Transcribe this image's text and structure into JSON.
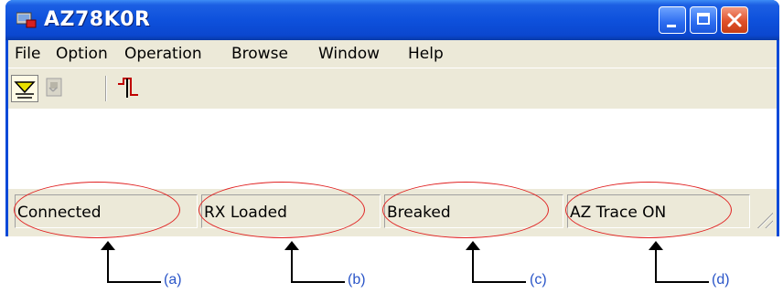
{
  "window": {
    "title": "AZ78K0R",
    "title_icon": "app-icon",
    "controls": [
      "minimize-icon",
      "maximize-icon",
      "close-icon"
    ]
  },
  "menu": {
    "items": [
      {
        "label": "File"
      },
      {
        "label": "Option"
      },
      {
        "label": "Operation"
      },
      {
        "label": "Browse"
      },
      {
        "label": "Window"
      },
      {
        "label": "Help"
      }
    ]
  },
  "toolbar": {
    "tools": [
      "filter-icon",
      "load-icon",
      "trace-signal-icon"
    ]
  },
  "statusbar": {
    "panes": [
      {
        "label": "Connected"
      },
      {
        "label": "RX Loaded"
      },
      {
        "label": "Breaked"
      },
      {
        "label": "AZ Trace ON"
      }
    ]
  },
  "annotations": {
    "labels": [
      "(a)",
      "(b)",
      "(c)",
      "(d)"
    ],
    "color": "#e02020",
    "label_color": "#2a55c8"
  }
}
